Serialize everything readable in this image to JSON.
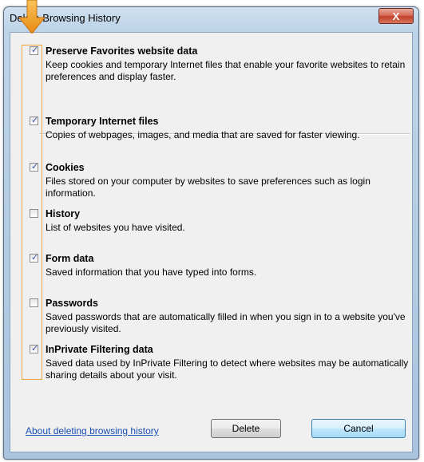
{
  "window": {
    "title": "Delete Browsing History",
    "close_label": "X"
  },
  "options": [
    {
      "label": "Preserve Favorites website data",
      "description": "Keep cookies and temporary Internet files that enable your favorite websites to retain preferences and display faster.",
      "checked": true
    },
    {
      "label": "Temporary Internet files",
      "description": "Copies of webpages, images, and media that are saved for faster viewing.",
      "checked": true
    },
    {
      "label": "Cookies",
      "description": "Files stored on your computer by websites to save preferences such as login information.",
      "checked": true
    },
    {
      "label": "History",
      "description": "List of websites you have visited.",
      "checked": false
    },
    {
      "label": "Form data",
      "description": "Saved information that you have typed into forms.",
      "checked": true
    },
    {
      "label": "Passwords",
      "description": "Saved passwords that are automatically filled in when you sign in to a website you've previously visited.",
      "checked": false
    },
    {
      "label": "InPrivate Filtering data",
      "description": "Saved data used by InPrivate Filtering to detect where websites may be automatically sharing details about your visit.",
      "checked": true
    }
  ],
  "footer": {
    "help_link": "About deleting browsing history",
    "delete_label": "Delete",
    "cancel_label": "Cancel"
  },
  "colors": {
    "highlight": "#f0a43a",
    "link": "#1a4fb3"
  }
}
